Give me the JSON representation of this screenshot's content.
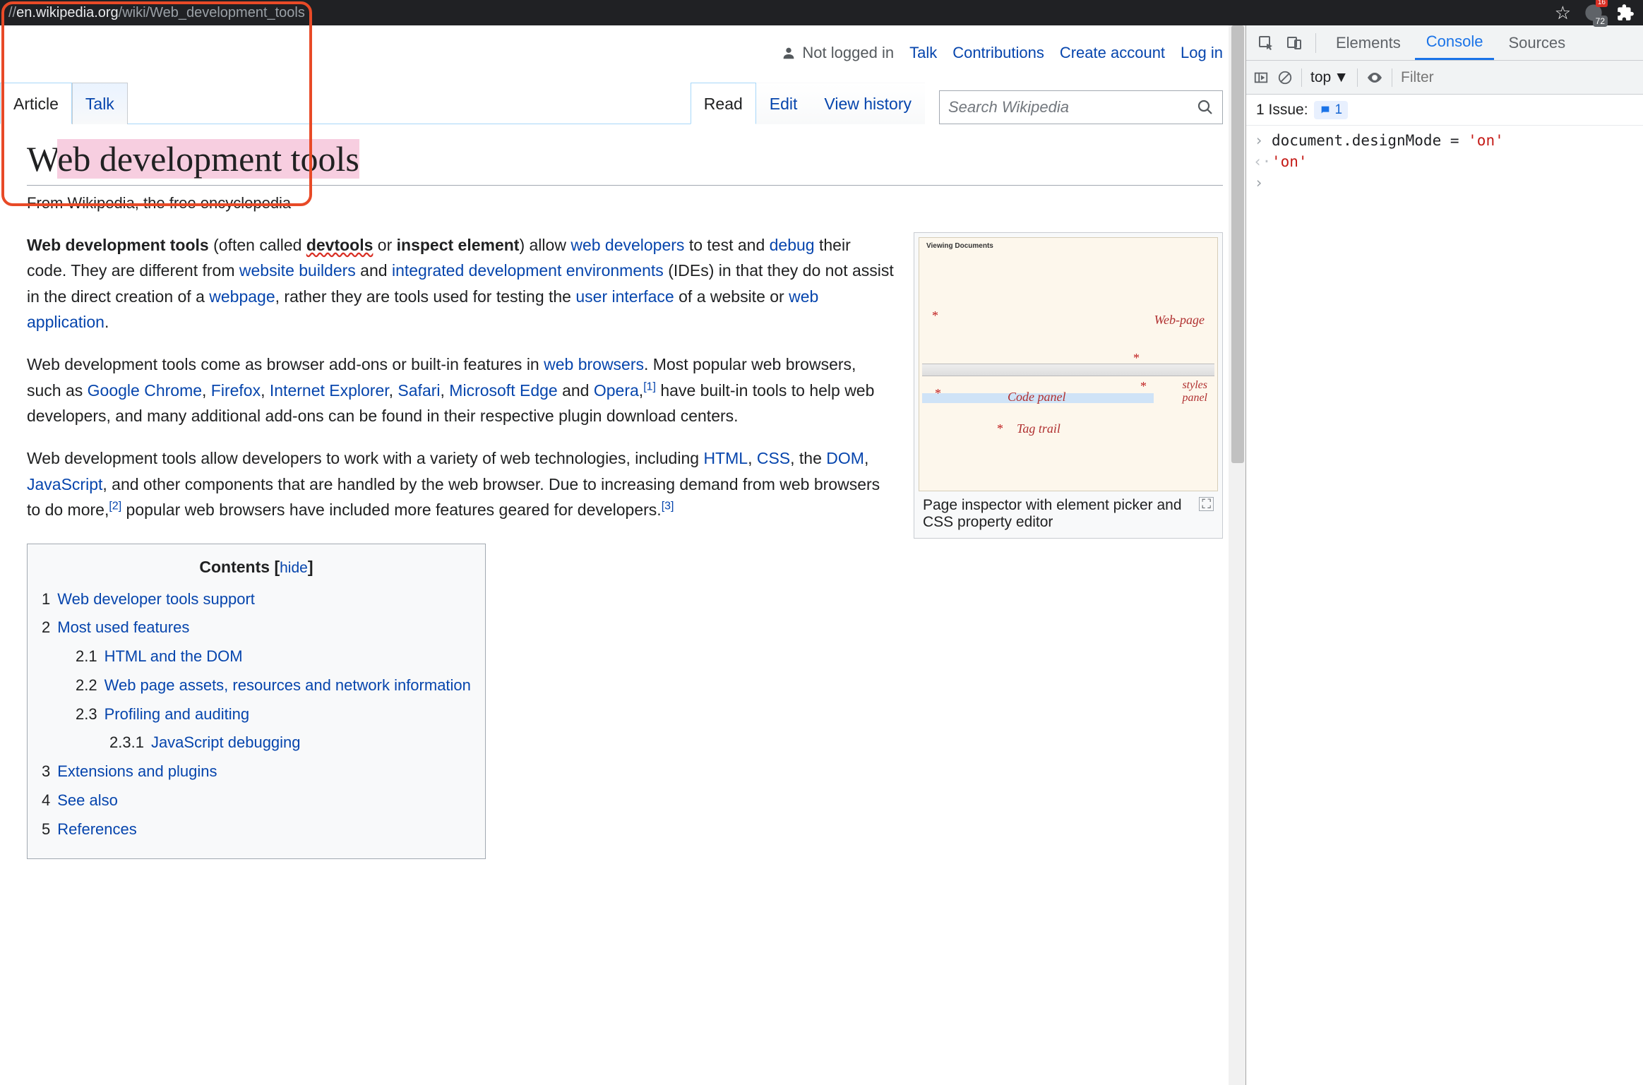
{
  "browser": {
    "url_prefix": "//",
    "url_host": "en.wikipedia.org",
    "url_path": "/wiki/Web_development_tools",
    "ext_badge_corner": "16",
    "ext_badge_count": "72"
  },
  "wiki": {
    "top_nav": {
      "not_logged": "Not logged in",
      "talk": "Talk",
      "contrib": "Contributions",
      "create": "Create account",
      "login": "Log in"
    },
    "tabs": {
      "article": "Article",
      "talk": "Talk",
      "read": "Read",
      "edit": "Edit",
      "view_history": "View history",
      "search_placeholder": "Search Wikipedia"
    },
    "title_plain": "W",
    "title_hl": "eb development tools",
    "subtitle": "From Wikipedia, the free encyclopedia",
    "p1": {
      "b1": "Web development tools",
      "t1": " (often called ",
      "b2": "devtools",
      "t2": " or ",
      "b3": "inspect element",
      "t3": ") allow ",
      "l1": "web developers",
      "t4": " to test and ",
      "l2": "debug",
      "t5": " their code. They are different from ",
      "l3": "website builders",
      "t6": " and ",
      "l4": "integrated development environments",
      "t7": " (IDEs) in that they do not assist in the direct creation of a ",
      "l5": "webpage",
      "t8": ", rather they are tools used for testing the ",
      "l6": "user interface",
      "t9": " of a website or ",
      "l7": "web application",
      "t10": "."
    },
    "p2": {
      "t1": "Web development tools come as browser add-ons or built-in features in ",
      "l1": "web browsers",
      "t2": ". Most popular web browsers, such as ",
      "l2": "Google Chrome",
      "c1": ", ",
      "l3": "Firefox",
      "c2": ", ",
      "l4": "Internet Explorer",
      "c3": ", ",
      "l5": "Safari",
      "c4": ", ",
      "l6": "Microsoft Edge",
      "t3": " and ",
      "l7": "Opera",
      "t4": ",",
      "sup1": "[1]",
      "t5": " have built-in tools to help web developers, and many additional add-ons can be found in their respective plugin download centers."
    },
    "p3": {
      "t1": "Web development tools allow developers to work with a variety of web technologies, including ",
      "l1": "HTML",
      "c1": ", ",
      "l2": "CSS",
      "c2": ", the ",
      "l3": "DOM",
      "c3": ", ",
      "l4": "JavaScript",
      "t2": ", and other components that are handled by the web browser. Due to increasing demand from web browsers to do more,",
      "sup2": "[2]",
      "t3": " popular web browsers have included more features geared for developers.",
      "sup3": "[3]"
    },
    "thumb": {
      "caption": "Page inspector with element picker and CSS property editor",
      "labels": {
        "hdr": "Viewing Documents",
        "wp": "Web-page",
        "cp": "Code panel",
        "sp": "styles\npanel",
        "tt": "Tag trail"
      }
    },
    "toc": {
      "title": "Contents",
      "hide": "hide",
      "items": [
        {
          "n": "1",
          "t": "Web developer tools support",
          "lvl": 1
        },
        {
          "n": "2",
          "t": "Most used features",
          "lvl": 1
        },
        {
          "n": "2.1",
          "t": "HTML and the DOM",
          "lvl": 2
        },
        {
          "n": "2.2",
          "t": "Web page assets, resources and network information",
          "lvl": 2
        },
        {
          "n": "2.3",
          "t": "Profiling and auditing",
          "lvl": 2
        },
        {
          "n": "2.3.1",
          "t": "JavaScript debugging",
          "lvl": 3
        },
        {
          "n": "3",
          "t": "Extensions and plugins",
          "lvl": 1
        },
        {
          "n": "4",
          "t": "See also",
          "lvl": 1
        },
        {
          "n": "5",
          "t": "References",
          "lvl": 1
        }
      ]
    }
  },
  "devtools": {
    "tabs": {
      "elements": "Elements",
      "console": "Console",
      "sources": "Sources"
    },
    "toolbar": {
      "context": "top",
      "filter_placeholder": "Filter"
    },
    "issues": {
      "label": "1 Issue:",
      "count": "1"
    },
    "console": {
      "input": "document.designMode = ",
      "input_str": "'on'",
      "output": "'on'"
    }
  }
}
